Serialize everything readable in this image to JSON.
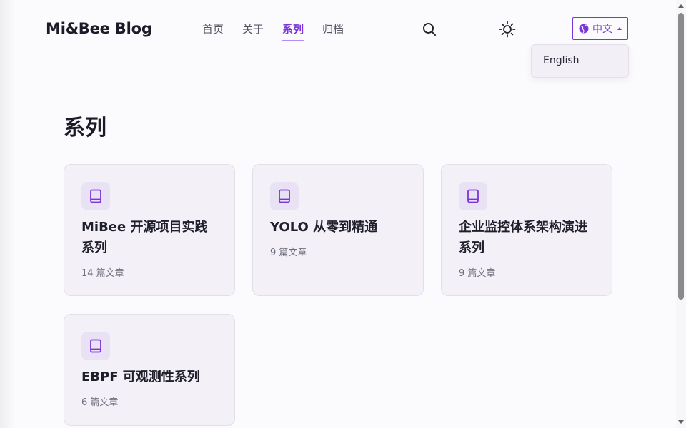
{
  "header": {
    "logo": "Mi&Bee Blog",
    "nav": [
      {
        "label": "首页",
        "active": false
      },
      {
        "label": "关于",
        "active": false
      },
      {
        "label": "系列",
        "active": true
      },
      {
        "label": "归档",
        "active": false
      }
    ],
    "search_icon": "search-icon",
    "theme_icon": "sun-icon",
    "language": {
      "current": "中文",
      "icon": "globe-icon",
      "options": [
        "English"
      ]
    }
  },
  "main": {
    "title": "系列",
    "series": [
      {
        "title": "MiBee 开源项目实践系列",
        "count": "14 篇文章",
        "icon": "book-icon"
      },
      {
        "title": "YOLO 从零到精通",
        "count": "9 篇文章",
        "icon": "book-icon"
      },
      {
        "title": "企业监控体系架构演进系列",
        "count": "9 篇文章",
        "icon": "book-icon"
      },
      {
        "title": "EBPF 可观测性系列",
        "count": "6 篇文章",
        "icon": "book-icon"
      }
    ]
  },
  "colors": {
    "accent": "#7b34d9",
    "card_bg": "#f3f0f7",
    "page_bg": "#fbfafc"
  }
}
